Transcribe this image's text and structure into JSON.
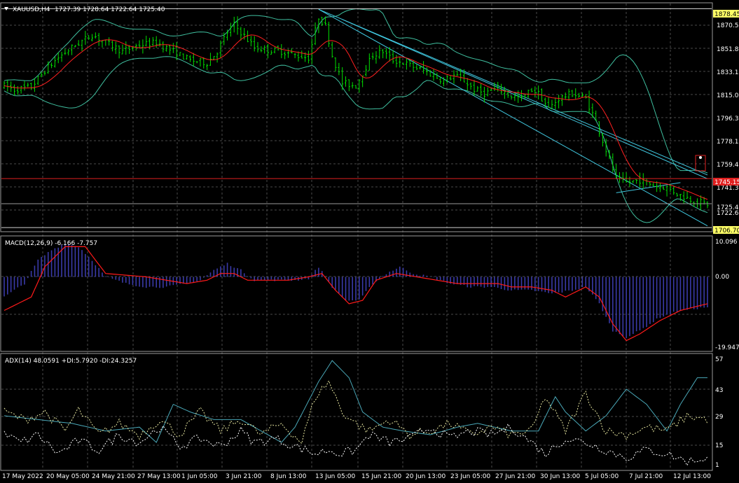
{
  "header": {
    "symbol": "XAUUSD,H4",
    "ohlc": "1727.39 1728.64 1722.64 1725.40",
    "macd_label": "MACD(12,26,9) -6.166 -7.757",
    "adx_label": "ADX(14) 48.0591 +DI:5.7920 -DI:24.3257"
  },
  "colors": {
    "background": "#000000",
    "grid": "#4a4a4a",
    "candle": "#00e000",
    "ma": "#ff2020",
    "bands": "#3fbf9f",
    "channel": "#40c8e0",
    "hline": "#e02020",
    "macd_hist": "#3a3aa8",
    "macd_signal": "#ff1a1a",
    "adx": "#4aa8b8",
    "plus_di": "#e8e8a0",
    "minus_di": "#ffffff"
  },
  "price_axis": {
    "ticks": [
      "1870.55",
      "1851.85",
      "1833.15",
      "1815.00",
      "1796.30",
      "1778.15",
      "1759.45",
      "1741.30",
      "1725.40",
      "1722.60"
    ],
    "marker_top": "1878.45",
    "marker_red": "1745.15",
    "marker_bottom": "1706.70"
  },
  "macd_axis": {
    "ticks": [
      "10.096",
      "0.00",
      "-19.947"
    ]
  },
  "adx_axis": {
    "ticks": [
      "57",
      "43",
      "29",
      "15",
      "1"
    ]
  },
  "time_axis": {
    "labels": [
      "17 May 2022",
      "20 May 05:00",
      "24 May 21:00",
      "27 May 13:00",
      "1 Jun 05:00",
      "3 Jun 21:00",
      "8 Jun 13:00",
      "13 Jun 05:00",
      "15 Jun 21:00",
      "20 Jun 13:00",
      "23 Jun 05:00",
      "27 Jun 21:00",
      "30 Jun 13:00",
      "5 Jul 05:00",
      "7 Jul 21:00",
      "12 Jul 13:00"
    ]
  },
  "chart_data": [
    {
      "type": "candlestick",
      "ylim": [
        1704,
        1882
      ],
      "close_anchors": [
        [
          0,
          1818
        ],
        [
          3,
          1815
        ],
        [
          8,
          1817
        ],
        [
          12,
          1830
        ],
        [
          16,
          1840
        ],
        [
          20,
          1848
        ],
        [
          26,
          1858
        ],
        [
          30,
          1852
        ],
        [
          35,
          1845
        ],
        [
          40,
          1850
        ],
        [
          45,
          1852
        ],
        [
          50,
          1845
        ],
        [
          55,
          1838
        ],
        [
          60,
          1836
        ],
        [
          63,
          1845
        ],
        [
          66,
          1860
        ],
        [
          68,
          1866
        ],
        [
          70,
          1860
        ],
        [
          74,
          1848
        ],
        [
          78,
          1846
        ],
        [
          82,
          1845
        ],
        [
          86,
          1842
        ],
        [
          90,
          1840
        ],
        [
          93,
          1872
        ],
        [
          95,
          1865
        ],
        [
          97,
          1842
        ],
        [
          100,
          1820
        ],
        [
          104,
          1818
        ],
        [
          106,
          1828
        ],
        [
          109,
          1842
        ],
        [
          112,
          1845
        ],
        [
          115,
          1838
        ],
        [
          118,
          1836
        ],
        [
          121,
          1833
        ],
        [
          124,
          1830
        ],
        [
          127,
          1826
        ],
        [
          130,
          1822
        ],
        [
          133,
          1826
        ],
        [
          136,
          1822
        ],
        [
          139,
          1815
        ],
        [
          142,
          1812
        ],
        [
          146,
          1816
        ],
        [
          150,
          1810
        ],
        [
          153,
          1808
        ],
        [
          156,
          1815
        ],
        [
          158,
          1812
        ],
        [
          161,
          1800
        ],
        [
          164,
          1808
        ],
        [
          168,
          1812
        ],
        [
          172,
          1808
        ],
        [
          175,
          1790
        ],
        [
          177,
          1775
        ],
        [
          179,
          1760
        ],
        [
          181,
          1745
        ],
        [
          184,
          1742
        ],
        [
          188,
          1744
        ],
        [
          192,
          1740
        ],
        [
          196,
          1738
        ],
        [
          200,
          1732
        ],
        [
          204,
          1728
        ],
        [
          208,
          1725
        ]
      ],
      "ma_period": 10,
      "bands_period": 20,
      "bands_k": 2
    },
    {
      "type": "macd",
      "ylim": [
        -22,
        12
      ],
      "signal_anchors": [
        [
          0,
          -10
        ],
        [
          8,
          -6
        ],
        [
          12,
          3
        ],
        [
          18,
          9
        ],
        [
          24,
          9
        ],
        [
          30,
          1
        ],
        [
          36,
          0.5
        ],
        [
          42,
          0
        ],
        [
          48,
          -1
        ],
        [
          54,
          -2
        ],
        [
          60,
          -1
        ],
        [
          64,
          1
        ],
        [
          68,
          1
        ],
        [
          72,
          -1
        ],
        [
          78,
          -1
        ],
        [
          84,
          -1
        ],
        [
          90,
          0
        ],
        [
          94,
          1
        ],
        [
          98,
          -4
        ],
        [
          102,
          -8
        ],
        [
          106,
          -7
        ],
        [
          110,
          -1
        ],
        [
          116,
          1
        ],
        [
          122,
          0
        ],
        [
          128,
          -1
        ],
        [
          134,
          -2
        ],
        [
          140,
          -2
        ],
        [
          146,
          -2
        ],
        [
          150,
          -3
        ],
        [
          156,
          -3
        ],
        [
          162,
          -4
        ],
        [
          166,
          -6
        ],
        [
          172,
          -3
        ],
        [
          176,
          -6
        ],
        [
          180,
          -14
        ],
        [
          184,
          -19
        ],
        [
          188,
          -17
        ],
        [
          194,
          -13
        ],
        [
          200,
          -10
        ],
        [
          208,
          -8
        ]
      ],
      "hist_anchors": [
        [
          0,
          -6
        ],
        [
          6,
          -2
        ],
        [
          10,
          5
        ],
        [
          14,
          8
        ],
        [
          18,
          10
        ],
        [
          22,
          9
        ],
        [
          26,
          5
        ],
        [
          30,
          0
        ],
        [
          36,
          -2
        ],
        [
          42,
          -3
        ],
        [
          48,
          -3
        ],
        [
          54,
          -2
        ],
        [
          58,
          -1
        ],
        [
          62,
          2
        ],
        [
          66,
          4
        ],
        [
          70,
          2
        ],
        [
          74,
          -1
        ],
        [
          80,
          -1
        ],
        [
          86,
          -1
        ],
        [
          90,
          -0.5
        ],
        [
          93,
          3
        ],
        [
          97,
          -3
        ],
        [
          101,
          -7
        ],
        [
          105,
          -7
        ],
        [
          109,
          -2
        ],
        [
          113,
          1
        ],
        [
          117,
          3
        ],
        [
          121,
          1
        ],
        [
          126,
          0
        ],
        [
          132,
          -2
        ],
        [
          138,
          -3
        ],
        [
          144,
          -3
        ],
        [
          150,
          -4
        ],
        [
          156,
          -4
        ],
        [
          162,
          -5
        ],
        [
          168,
          -4
        ],
        [
          172,
          -3
        ],
        [
          176,
          -8
        ],
        [
          180,
          -16
        ],
        [
          184,
          -18
        ],
        [
          188,
          -16
        ],
        [
          194,
          -12
        ],
        [
          200,
          -10
        ],
        [
          208,
          -9
        ]
      ]
    },
    {
      "type": "line",
      "ylim": [
        0,
        60
      ],
      "series": [
        {
          "key": "adx",
          "anchors": [
            [
              0,
              28
            ],
            [
              10,
              26
            ],
            [
              20,
              24
            ],
            [
              30,
              20
            ],
            [
              40,
              22
            ],
            [
              45,
              14
            ],
            [
              50,
              34
            ],
            [
              55,
              30
            ],
            [
              62,
              26
            ],
            [
              70,
              26
            ],
            [
              76,
              20
            ],
            [
              82,
              14
            ],
            [
              86,
              22
            ],
            [
              93,
              46
            ],
            [
              97,
              57
            ],
            [
              102,
              48
            ],
            [
              106,
              30
            ],
            [
              112,
              22
            ],
            [
              118,
              20
            ],
            [
              126,
              18
            ],
            [
              134,
              22
            ],
            [
              140,
              24
            ],
            [
              150,
              20
            ],
            [
              158,
              20
            ],
            [
              163,
              38
            ],
            [
              166,
              30
            ],
            [
              172,
              20
            ],
            [
              178,
              28
            ],
            [
              184,
              42
            ],
            [
              190,
              34
            ],
            [
              196,
              20
            ],
            [
              200,
              34
            ],
            [
              205,
              48
            ],
            [
              208,
              48
            ]
          ]
        },
        {
          "key": "plus_di",
          "anchors": [
            [
              0,
              30
            ],
            [
              6,
              26
            ],
            [
              12,
              30
            ],
            [
              18,
              20
            ],
            [
              22,
              31
            ],
            [
              28,
              18
            ],
            [
              34,
              24
            ],
            [
              40,
              18
            ],
            [
              46,
              26
            ],
            [
              52,
              18
            ],
            [
              58,
              30
            ],
            [
              64,
              20
            ],
            [
              70,
              26
            ],
            [
              76,
              18
            ],
            [
              82,
              24
            ],
            [
              88,
              14
            ],
            [
              92,
              38
            ],
            [
              96,
              46
            ],
            [
              100,
              30
            ],
            [
              104,
              24
            ],
            [
              108,
              20
            ],
            [
              114,
              26
            ],
            [
              120,
              18
            ],
            [
              126,
              20
            ],
            [
              132,
              24
            ],
            [
              138,
              18
            ],
            [
              144,
              22
            ],
            [
              150,
              18
            ],
            [
              156,
              20
            ],
            [
              160,
              38
            ],
            [
              166,
              20
            ],
            [
              172,
              40
            ],
            [
              178,
              20
            ],
            [
              184,
              18
            ],
            [
              190,
              22
            ],
            [
              196,
              20
            ],
            [
              202,
              28
            ],
            [
              208,
              26
            ]
          ]
        },
        {
          "key": "minus_di",
          "anchors": [
            [
              0,
              18
            ],
            [
              5,
              14
            ],
            [
              10,
              18
            ],
            [
              16,
              8
            ],
            [
              22,
              15
            ],
            [
              28,
              10
            ],
            [
              34,
              18
            ],
            [
              40,
              14
            ],
            [
              46,
              22
            ],
            [
              52,
              12
            ],
            [
              58,
              16
            ],
            [
              64,
              12
            ],
            [
              70,
              20
            ],
            [
              74,
              14
            ],
            [
              80,
              16
            ],
            [
              86,
              12
            ],
            [
              92,
              8
            ],
            [
              96,
              10
            ],
            [
              100,
              8
            ],
            [
              104,
              10
            ],
            [
              108,
              18
            ],
            [
              114,
              14
            ],
            [
              120,
              16
            ],
            [
              126,
              22
            ],
            [
              132,
              16
            ],
            [
              138,
              20
            ],
            [
              144,
              18
            ],
            [
              150,
              22
            ],
            [
              156,
              14
            ],
            [
              160,
              8
            ],
            [
              166,
              16
            ],
            [
              172,
              14
            ],
            [
              178,
              10
            ],
            [
              184,
              6
            ],
            [
              190,
              10
            ],
            [
              196,
              8
            ],
            [
              202,
              4
            ],
            [
              208,
              6
            ]
          ]
        }
      ]
    }
  ]
}
